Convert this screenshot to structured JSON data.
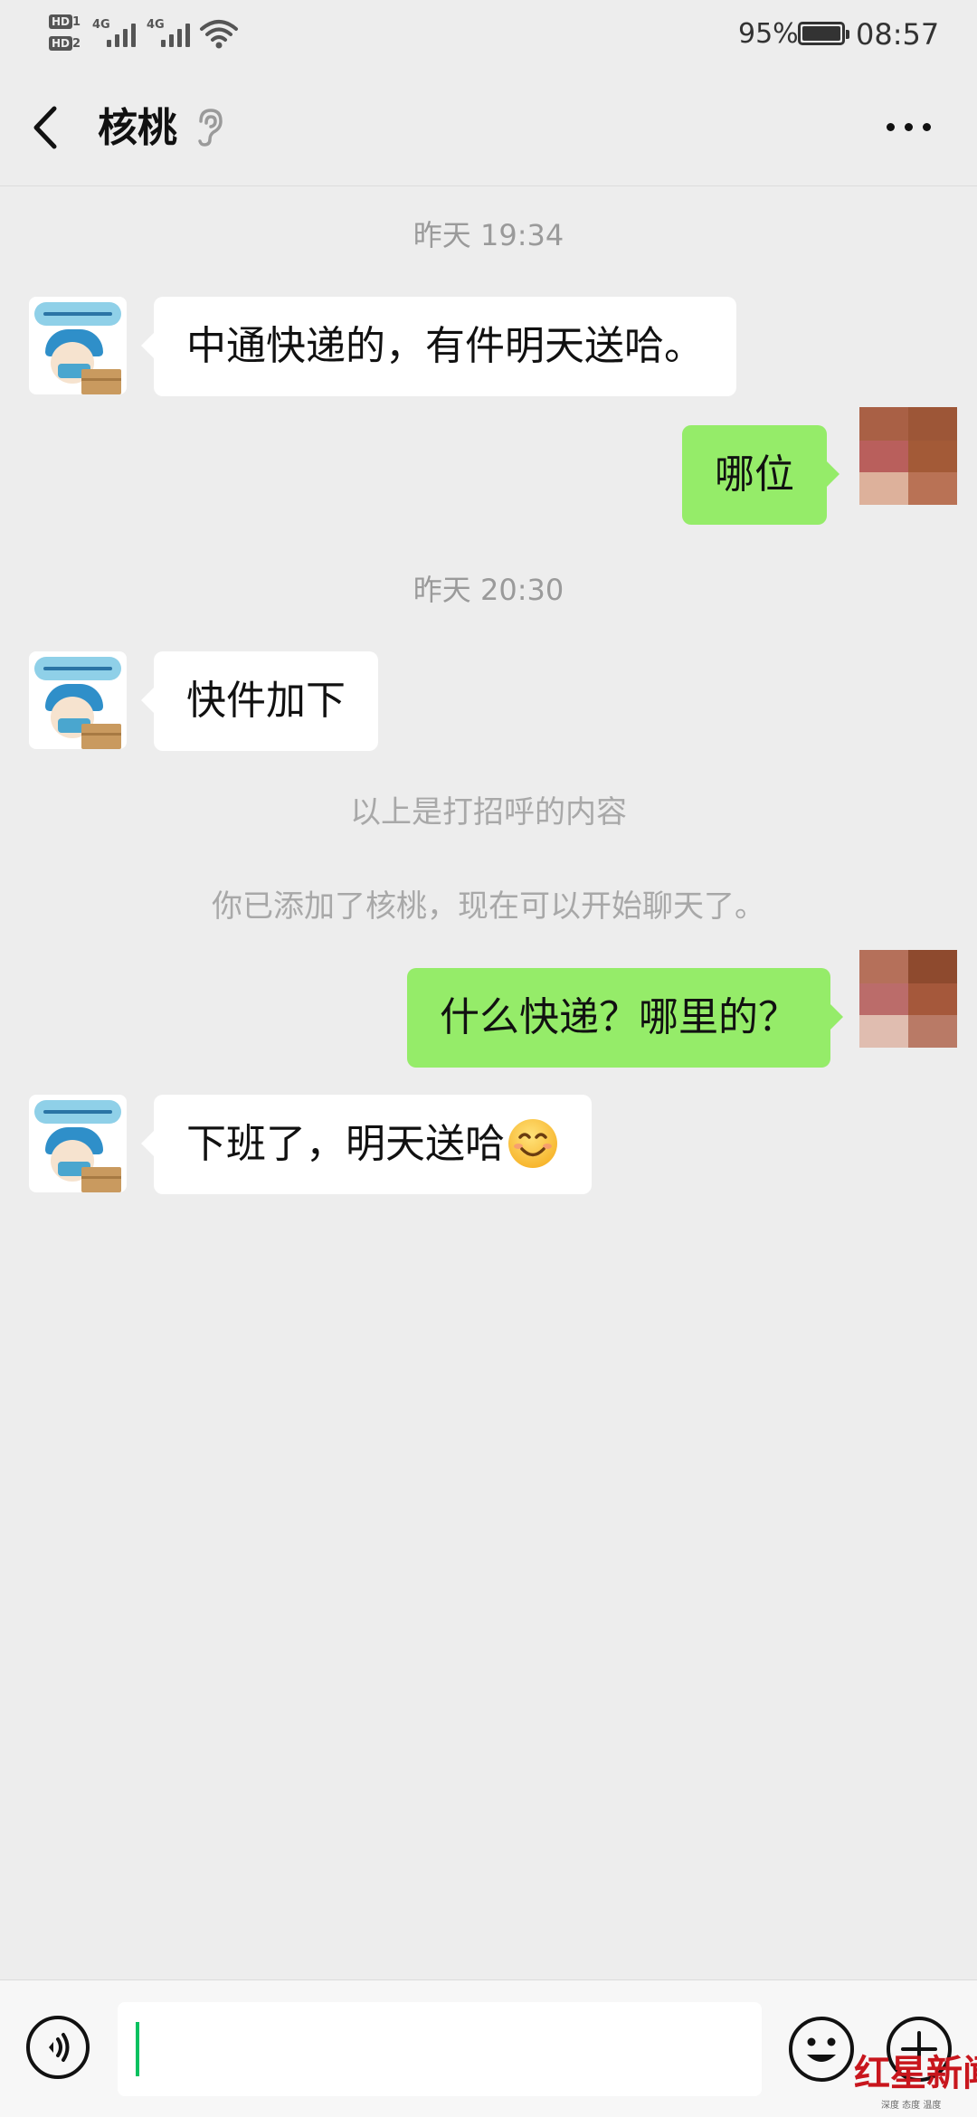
{
  "status_bar": {
    "hd1": "HD",
    "hd1_sub": "1",
    "hd2": "HD",
    "hd2_sub": "2",
    "net1": "4G",
    "net2": "4G",
    "battery": "95%",
    "battery_level": 0.95,
    "time": "08:57",
    "icons": [
      "signal-icon",
      "wifi-icon",
      "battery-icon"
    ]
  },
  "header": {
    "title": "核桃",
    "icons": [
      "back-icon",
      "ear-icon",
      "more-icon"
    ]
  },
  "messages": [
    {
      "type": "timestamp",
      "text": "昨天 19:34"
    },
    {
      "type": "incoming",
      "sender": "核桃",
      "text": "中通快递的，有件明天送哈。"
    },
    {
      "type": "outgoing",
      "text": "哪位"
    },
    {
      "type": "timestamp",
      "text": "昨天 20:30"
    },
    {
      "type": "incoming",
      "sender": "核桃",
      "text": "快件加下"
    },
    {
      "type": "system",
      "text": "以上是打招呼的内容"
    },
    {
      "type": "system",
      "text": "你已添加了核桃，现在可以开始聊天了。"
    },
    {
      "type": "outgoing",
      "text": "什么快递？哪里的？"
    },
    {
      "type": "incoming",
      "sender": "核桃",
      "text": "下班了，明天送哈",
      "emoji": "smile-emoji"
    }
  ],
  "input_bar": {
    "value": "",
    "icons": [
      "voice-icon",
      "emoji-icon",
      "plus-icon"
    ]
  },
  "watermark": {
    "title": "红星新闻",
    "subtitle": "深度 态度 温度"
  },
  "colors": {
    "background": "#ededed",
    "outgoing_bubble": "#95ec69",
    "incoming_bubble": "#ffffff",
    "cursor": "#07c160",
    "watermark": "#c8161d"
  }
}
